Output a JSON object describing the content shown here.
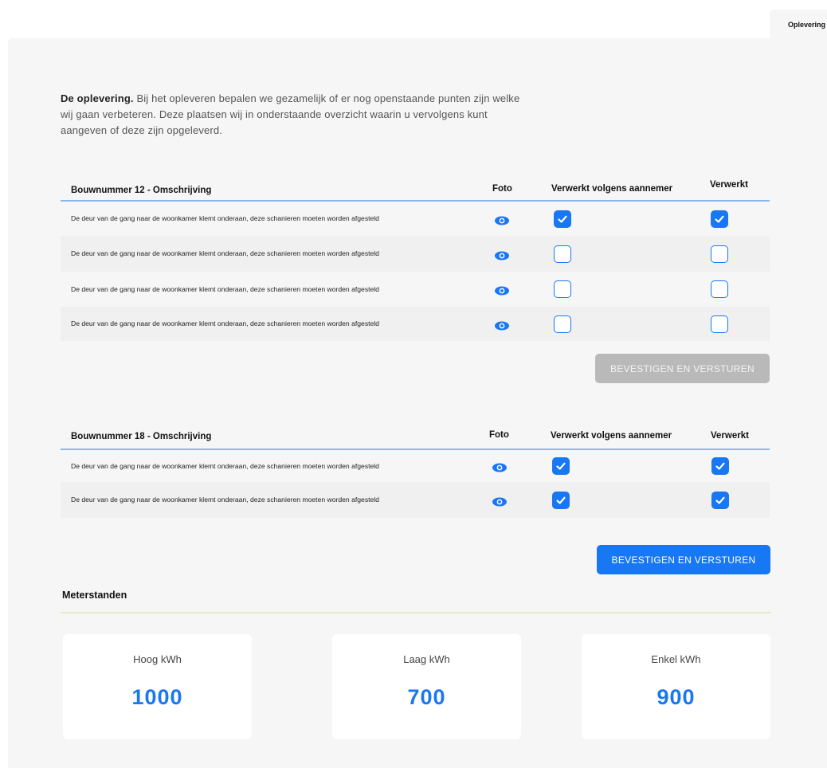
{
  "tab": {
    "label": "Oplevering"
  },
  "intro": {
    "title": "De oplevering.",
    "text": " Bij het opleveren bepalen we gezamelijk of er nog openstaande punten zijn welke wij gaan verbeteren. Deze plaatsen wij in onderstaande overzicht waarin u vervolgens kunt aangeven of deze zijn opgeleverd."
  },
  "tables": [
    {
      "title": "Bouwnummer 12 - Omschrijving",
      "col_foto": "Foto",
      "col_aannemer": "Verwerkt volgens aannemer",
      "col_verwerkt": "Verwerkt",
      "rows": [
        {
          "description": "De deur van de gang naar de woonkamer klemt onderaan, deze schanieren moeten worden afgesteld",
          "aannemer": true,
          "verwerkt": true
        },
        {
          "description": "De deur van de gang naar de woonkamer klemt onderaan, deze schanieren moeten worden afgesteld",
          "aannemer": false,
          "verwerkt": false
        },
        {
          "description": "De deur van de gang naar de woonkamer klemt onderaan, deze schanieren moeten worden afgesteld",
          "aannemer": false,
          "verwerkt": false
        },
        {
          "description": "De deur van de gang naar de woonkamer klemt onderaan, deze schanieren moeten worden afgesteld",
          "aannemer": false,
          "verwerkt": false
        }
      ],
      "button": "BEVESTIGEN EN VERSTUREN",
      "button_state": "disabled"
    },
    {
      "title": "Bouwnummer 18 - Omschrijving",
      "col_foto": "Foto",
      "col_aannemer": "Verwerkt volgens aannemer",
      "col_verwerkt": "Verwerkt",
      "rows": [
        {
          "description": "De deur van de gang naar de woonkamer klemt onderaan, deze schanieren moeten worden afgesteld",
          "aannemer": true,
          "verwerkt": true
        },
        {
          "description": "De deur van de gang naar de woonkamer klemt onderaan, deze schanieren moeten worden afgesteld",
          "aannemer": true,
          "verwerkt": true
        }
      ],
      "button": "BEVESTIGEN EN VERSTUREN",
      "button_state": "enabled"
    }
  ],
  "meters": {
    "title": "Meterstanden",
    "items": [
      {
        "label": "Hoog kWh",
        "value": "1000"
      },
      {
        "label": "Laag kWh",
        "value": "700"
      },
      {
        "label": "Enkel kWh",
        "value": "900"
      }
    ]
  },
  "colors": {
    "accent": "#1877f2",
    "disabled": "#b9b9b9",
    "panel": "#f6f6f6",
    "header_line": "#8ab8ee"
  },
  "icons": {
    "photo": "eye-icon",
    "checked": "checkmark-icon"
  }
}
